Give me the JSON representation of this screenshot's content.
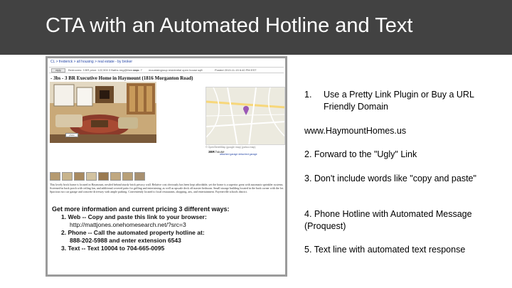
{
  "slide": {
    "title": "CTA with an Automated Hotline and Text"
  },
  "screenshot": {
    "breadcrumb": "CL > frederick > all housing > real estate - by broker",
    "meta": [
      "Bedrooms: 3 BR  price: 122,900  3 Baths  rmg@thee.com",
      "days: 7",
      "mountaingroup   residential   open house   sqft",
      "Posted 2013-11-15  6:40 PM EST"
    ],
    "badge": "reply",
    "listing_title": "- 3bs - 3 BR Executive Home in Haymount (1816 Morganton Road)",
    "photo_label": "photo",
    "map_footer": "© OpenStreetMap   (google map)   (yahoo map)",
    "details_label": "3BR",
    "details_sub": "house",
    "detail_tags": "attached garage   detached garage",
    "description": "This lovely brick home is located in Haymount, nestled behind sturdy brick privacy wall. Relative cost obviously has been kept affordable, yet the home is a superior great with automatic sprinkler systems. Screened-in back porch with ceiling fan, and additional covered patio for grilling and entertaining, as well as upscale deck off master bedroom. Small storage building located in the back corner with the lot. Spacious two car garage and concrete driveway with ample parking. Conveniently located to local restaurants, shopping, arts, and entertainment. Fayetteville schools district.",
    "instructions": {
      "heading": "Get more information and current pricing 3 different ways:",
      "lines": [
        "1.  Web -- Copy and paste this link to your browser:",
        "http://mattjones.onehomesearch.net/?src=3",
        "2.  Phone -- Call the automated property hotline at:",
        "888-202-5988 and enter extension 6543",
        "3.  Text -- Text 10004 to 704-665-0095"
      ]
    }
  },
  "notes": [
    {
      "num": "1.",
      "text": "Use a Pretty Link Plugin or Buy a URL Friendly Domain"
    },
    {
      "num": "",
      "text": "www.HaymountHomes.us"
    },
    {
      "num": "",
      "text": "2. Forward to the \"Ugly\" Link"
    },
    {
      "num": "",
      "text": "3. Don't include words like \"copy and paste\""
    },
    {
      "num": "",
      "text": "4. Phone Hotline with Automated Message (Proquest)"
    },
    {
      "num": "",
      "text": "5. Text line with automated text response"
    }
  ],
  "colors": {
    "title_bar": "#424242",
    "title_text": "#ffffff",
    "frame": "#9b9b9b",
    "link": "#2a4aa8"
  }
}
